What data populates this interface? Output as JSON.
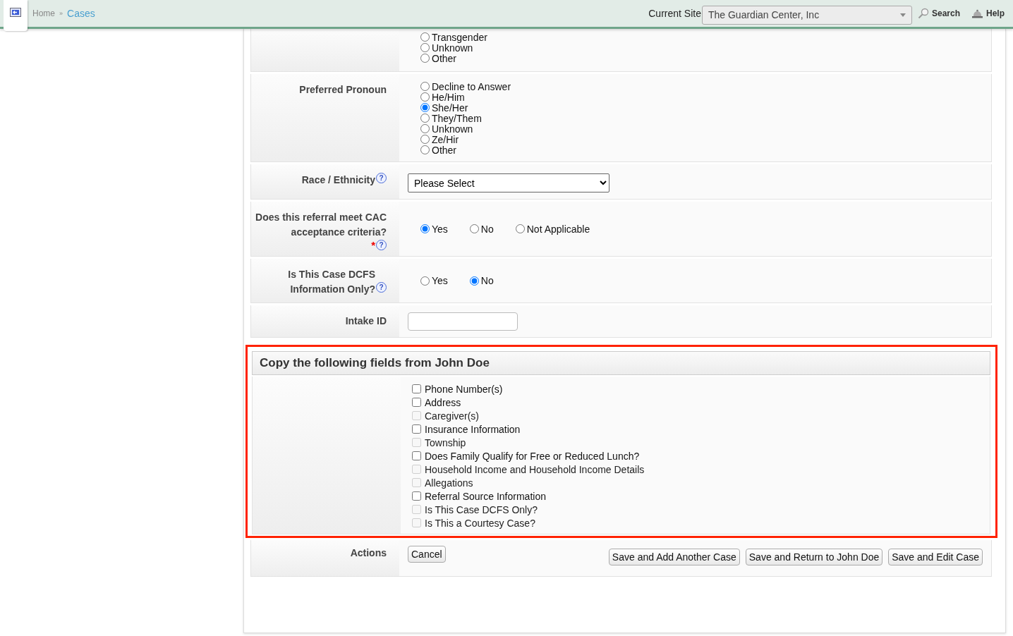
{
  "header": {
    "breadcrumbs": [
      {
        "label": "Home",
        "kind": "plain"
      },
      {
        "label": "Cases",
        "kind": "link"
      }
    ],
    "separator": "»",
    "site_label": "Current Site",
    "site_value": "The Guardian Center, Inc",
    "search": "Search",
    "help": "Help"
  },
  "form": {
    "rows": [
      {
        "label": "",
        "kind": "radio-list",
        "options": [
          {
            "label": "Transgender",
            "selected": false
          },
          {
            "label": "Unknown",
            "selected": false
          },
          {
            "label": "Other",
            "selected": false
          }
        ]
      },
      {
        "label": "Preferred Pronoun",
        "kind": "radio-list",
        "options": [
          {
            "label": "Decline to Answer",
            "selected": false
          },
          {
            "label": "He/Him",
            "selected": false
          },
          {
            "label": "She/Her",
            "selected": true
          },
          {
            "label": "They/Them",
            "selected": false
          },
          {
            "label": "Unknown",
            "selected": false
          },
          {
            "label": "Ze/Hir",
            "selected": false
          },
          {
            "label": "Other",
            "selected": false
          }
        ]
      },
      {
        "label": "Race / Ethnicity",
        "help": "?",
        "kind": "select",
        "value": "Please Select"
      },
      {
        "label": "Does this referral meet CAC acceptance criteria?",
        "required_mark": "*",
        "help": "?",
        "kind": "radio-inline",
        "options": [
          {
            "label": "Yes",
            "selected": true
          },
          {
            "label": "No",
            "selected": false
          },
          {
            "label": "Not Applicable",
            "selected": false
          }
        ]
      },
      {
        "label": "Is This Case DCFS Information Only?",
        "help": "?",
        "kind": "radio-inline",
        "options": [
          {
            "label": "Yes",
            "selected": false
          },
          {
            "label": "No",
            "selected": true
          }
        ]
      },
      {
        "label": "Intake ID",
        "kind": "text-input"
      }
    ]
  },
  "copy_section": {
    "title": "Copy the following fields from John Doe",
    "highlighted": true,
    "fields": [
      {
        "label": "Phone Number(s)",
        "checked": false,
        "disabled": false
      },
      {
        "label": "Address",
        "checked": false,
        "disabled": false
      },
      {
        "label": "Caregiver(s)",
        "checked": false,
        "disabled": true
      },
      {
        "label": "Insurance Information",
        "checked": false,
        "disabled": false
      },
      {
        "label": "Township",
        "checked": false,
        "disabled": true
      },
      {
        "label": "Does Family Qualify for Free or Reduced Lunch?",
        "checked": false,
        "disabled": false
      },
      {
        "label": "Household Income and Household Income Details",
        "checked": false,
        "disabled": true
      },
      {
        "label": "Allegations",
        "checked": false,
        "disabled": true
      },
      {
        "label": "Referral Source Information",
        "checked": false,
        "disabled": false
      },
      {
        "label": "Is This Case DCFS Only?",
        "checked": false,
        "disabled": true
      },
      {
        "label": "Is This a Courtesy Case?",
        "checked": false,
        "disabled": true
      }
    ]
  },
  "actions": {
    "label": "Actions",
    "buttons": [
      {
        "label": "Cancel",
        "kind": "cancel"
      },
      {
        "label": "Save and Add Another Case",
        "kind": "save"
      },
      {
        "label": "Save and Return to John Doe",
        "kind": "save"
      },
      {
        "label": "Save and Edit Case",
        "kind": "save"
      }
    ]
  }
}
